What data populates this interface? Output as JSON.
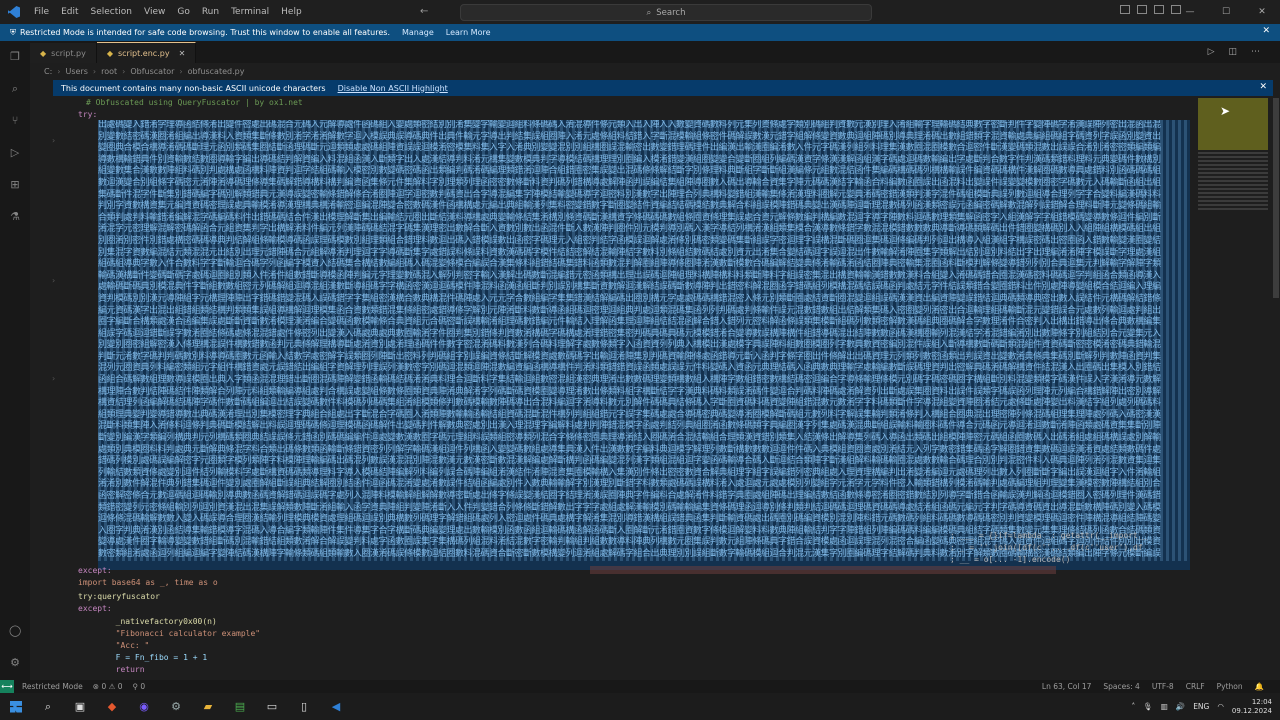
{
  "menu": [
    "File",
    "Edit",
    "Selection",
    "View",
    "Go",
    "Run",
    "Terminal",
    "Help"
  ],
  "search_label": "Search",
  "restricted_banner": {
    "text": "Restricted Mode is intended for safe code browsing. Trust this window to enable all features.",
    "manage": "Manage",
    "learn_more": "Learn More"
  },
  "tabs": [
    {
      "label": "script.py",
      "active": false
    },
    {
      "label": "script.enc.py",
      "active": true
    }
  ],
  "breadcrumb": [
    "C:",
    "Users",
    "root",
    "Obfuscator",
    "obfuscated.py"
  ],
  "nonascii_banner": {
    "text": "This document contains many non-basic ASCII unicode characters",
    "action": "Disable Non ASCII Highlight"
  },
  "code_top": [
    {
      "text": "# Obfuscated using QueryFuscator | by ox1.net"
    },
    {
      "text": "try:"
    }
  ],
  "code_bottom": [
    {
      "text": "except:"
    },
    {
      "text": "import base64 as _, time as o"
    },
    {
      "text": "try:queryfuscator"
    },
    {
      "text": "except:"
    },
    {
      "text": "  _nativefactory0x00(n)"
    },
    {
      "text": "  \"Fibonacci calculator example\""
    },
    {
      "text": "  \"Acc: \""
    },
    {
      "text": "  F = Fn_fibo = 1 + 1"
    },
    {
      "text": "  return"
    }
  ],
  "overlay_code": [
    "; ___ = {}if=lambda _: getattr(__import__",
    "; _ = ''.join([df(c'',...df(c''user'),df",
    "; __ = o[... -1].encode()"
  ],
  "status": {
    "mode": "Restricted Mode",
    "problems": "0",
    "warnings": "0",
    "ports": "0",
    "position": "Ln 63, Col 17",
    "spaces": "Spaces: 4",
    "encoding": "UTF-8",
    "eol": "CRLF",
    "language": "Python"
  },
  "taskbar": {
    "lang": "ENG",
    "time": "12:04",
    "date": "09.12.2024"
  },
  "colors": {
    "banner": "#0e4f80",
    "accent": "#2f80d6",
    "highlight": "#13314f"
  }
}
